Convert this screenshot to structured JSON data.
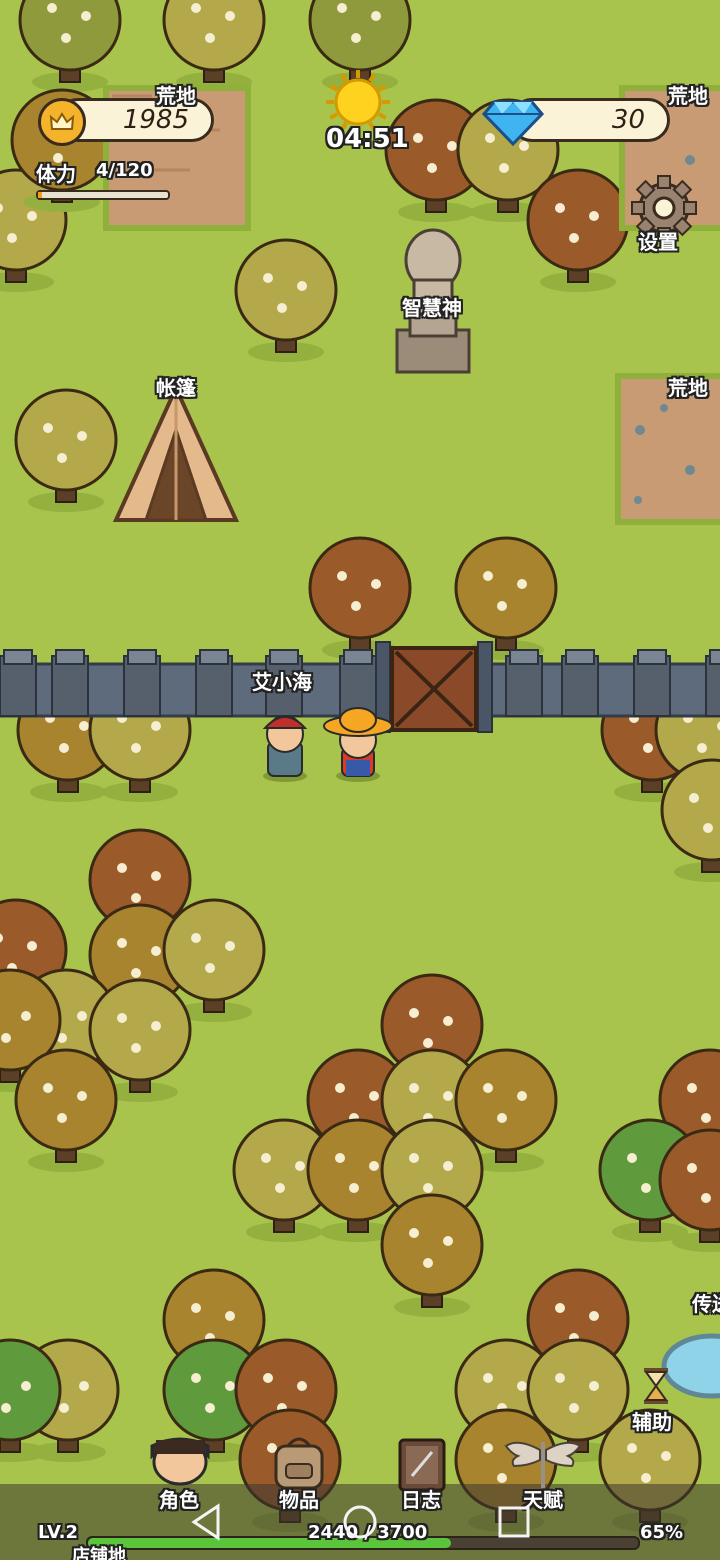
{
  "hud": {
    "gold": "1985",
    "gems": "30",
    "clock": "04:51",
    "stamina_label": "体力",
    "stamina_value": "4/120",
    "stamina_fraction": 0.033
  },
  "map_labels": {
    "wasteland_top_left": "荒地",
    "wasteland_top_right": "荒地",
    "wasteland_mid_right": "荒地",
    "tent": "帐篷",
    "statue": "智慧神",
    "settings": "设置",
    "npc_name": "艾小海",
    "teleport": "传送",
    "assist": "辅助",
    "bottom_place": "店铺地"
  },
  "nav": {
    "items": [
      {
        "label": "角色",
        "icon": "character-icon"
      },
      {
        "label": "物品",
        "icon": "backpack-icon"
      },
      {
        "label": "日志",
        "icon": "journal-icon"
      },
      {
        "label": "天赋",
        "icon": "talent-wings-icon"
      }
    ]
  },
  "level": {
    "label": "LV.2",
    "xp_text": "2440 / 3700",
    "xp_fraction": 0.66,
    "percent": "65%"
  },
  "colors": {
    "grass": "#a9c44c",
    "wall": "#5d6b7d",
    "gate": "#8a4a2a",
    "gold_coin": "#f4b32a",
    "gem": "#3fb4f0"
  }
}
